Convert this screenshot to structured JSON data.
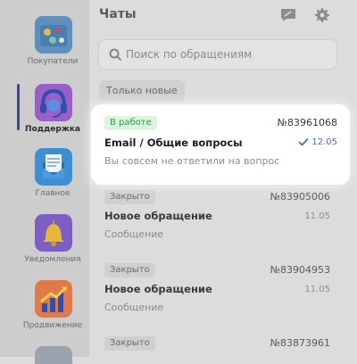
{
  "sidebar": {
    "items": [
      {
        "label": "Покупатели",
        "icon": "customers-icon"
      },
      {
        "label": "Поддержка",
        "icon": "support-headset-icon",
        "active": true
      },
      {
        "label": "Главное",
        "icon": "envelope-news-icon"
      },
      {
        "label": "Уведомления",
        "icon": "bell-icon"
      },
      {
        "label": "Продвижение",
        "icon": "growth-chart-icon"
      }
    ]
  },
  "header": {
    "title": "Чаты",
    "icons": [
      "compose-chat-icon",
      "gear-icon"
    ]
  },
  "search": {
    "placeholder": "Поиск по обращениям"
  },
  "filter": {
    "chip": "Только новые"
  },
  "highlighted": {
    "status": "В работе",
    "number": "№83961068",
    "title": "Email / Общие вопросы",
    "date": "12.05",
    "message": "Вы совсем не ответили на вопрос"
  },
  "tickets": [
    {
      "status": "Закрыто",
      "number": "№83905006",
      "title": "Новое обращение",
      "date": "11.05",
      "message": "Сообщение"
    },
    {
      "status": "Закрыто",
      "number": "№83904953",
      "title": "Новое обращение",
      "date": "11.05",
      "message": "Сообщение"
    },
    {
      "status": "Закрыто",
      "number": "№83873961",
      "title": "",
      "date": "",
      "message": ""
    }
  ],
  "colors": {
    "accent": "#3c46a0",
    "status_work_bg": "#dcf5dc",
    "status_work_text": "#2e9a4c",
    "status_closed_bg": "#d0d0d0"
  }
}
